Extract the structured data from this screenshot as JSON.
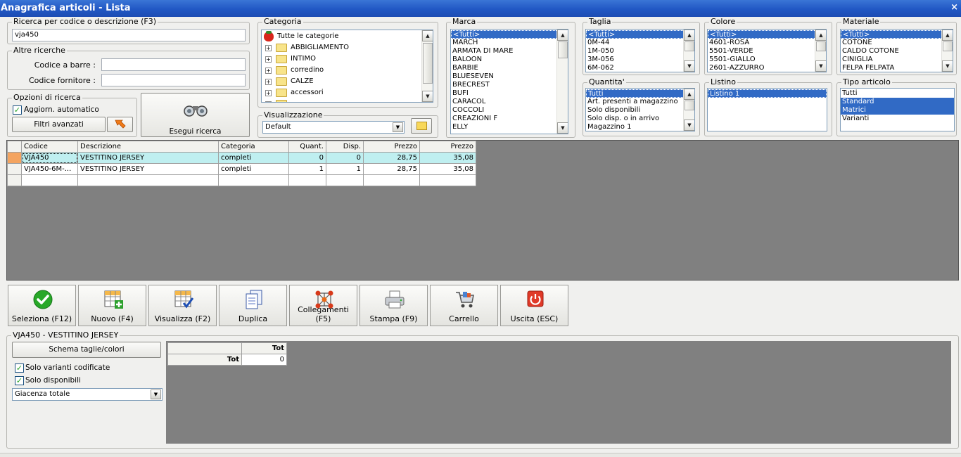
{
  "window": {
    "title": "Anagrafica articoli  - Lista",
    "close": "×"
  },
  "search": {
    "legend": "Ricerca per codice o descrizione (F3)",
    "value": "vja450"
  },
  "other_search": {
    "legend": "Altre ricerche",
    "barcode_label": "Codice a barre :",
    "barcode_value": "",
    "supplier_label": "Codice fornitore :",
    "supplier_value": ""
  },
  "search_options": {
    "legend": "Opzioni di ricerca",
    "auto_update_label": "Aggiorn. automatico",
    "auto_update_checked": true,
    "advanced_filters_label": "Filtri avanzati",
    "run_search_label": "Esegui ricerca"
  },
  "category": {
    "legend": "Categoria",
    "root": "Tutte le categorie",
    "items": [
      "ABBIGLIAMENTO",
      "INTIMO",
      "corredino",
      "CALZE",
      "accessori"
    ]
  },
  "view": {
    "legend": "Visualizzazione",
    "selected": "Default"
  },
  "brand": {
    "legend": "Marca",
    "items": [
      "<Tutti>",
      "MARCH",
      "ARMATA DI MARE",
      "BALOON",
      "BARBIE",
      "BLUESEVEN",
      "BRECREST",
      "BUFI",
      "CARACOL",
      "COCCOLI",
      "CREAZIONI F",
      "ELLY"
    ],
    "selected_index": 0
  },
  "size": {
    "legend": "Taglia",
    "items": [
      "<Tutti>",
      "0M-44",
      "1M-050",
      "3M-056",
      "6M-062"
    ],
    "selected_index": 0
  },
  "color": {
    "legend": "Colore",
    "items": [
      "<Tutti>",
      "4601-ROSA",
      "5501-VERDE",
      "5501-GIALLO",
      "2601-AZZURRO"
    ],
    "selected_index": 0
  },
  "material": {
    "legend": "Materiale",
    "items": [
      "<Tutti>",
      "COTONE",
      "CALDO COTONE",
      "CINIGLIA",
      "FELPA FELPATA"
    ],
    "selected_index": 0
  },
  "quantity": {
    "legend": "Quantita'",
    "items": [
      "Tutti",
      "Art. presenti a magazzino",
      "Solo disponibili",
      "Solo disp. o in arrivo",
      "Magazzino 1"
    ],
    "selected_index": 0
  },
  "price_list": {
    "legend": "Listino",
    "items": [
      "Listino 1"
    ],
    "selected_index": 0
  },
  "article_type": {
    "legend": "Tipo articolo",
    "items": [
      "Tutti",
      "Standard",
      "Matrici",
      "Varianti"
    ],
    "selected": [
      1,
      2
    ]
  },
  "grid": {
    "columns": [
      "Codice",
      "Descrizione",
      "Categoria",
      "Quant.",
      "Disp.",
      "Prezzo",
      "Prezzo"
    ],
    "rows": [
      [
        "VJA450",
        "VESTITINO JERSEY",
        "completi",
        "0",
        "0",
        "28,75",
        "35,08"
      ],
      [
        "VJA450-6M-...",
        "VESTITINO JERSEY",
        "completi",
        "1",
        "1",
        "28,75",
        "35,08"
      ]
    ]
  },
  "toolbar": [
    {
      "label": "Seleziona (F12)",
      "icon": "check-icon"
    },
    {
      "label": "Nuovo (F4)",
      "icon": "new-grid-icon"
    },
    {
      "label": "Visualizza (F2)",
      "icon": "view-grid-icon"
    },
    {
      "label": "Duplica",
      "icon": "duplicate-icon"
    },
    {
      "label": "Collegamenti (F5)",
      "icon": "links-icon"
    },
    {
      "label": "Stampa (F9)",
      "icon": "printer-icon"
    },
    {
      "label": "Carrello",
      "icon": "cart-icon"
    },
    {
      "label": "Uscita (ESC)",
      "icon": "power-icon"
    }
  ],
  "detail": {
    "legend": "VJA450 - VESTITINO JERSEY",
    "scheme_button": "Schema taglie/colori",
    "only_coded_variants": "Solo varianti codificate",
    "only_coded_checked": true,
    "only_available": "Solo disponibili",
    "only_available_checked": true,
    "stock_combo": "Giacenza totale",
    "matrix_col": "Tot",
    "matrix_row": "Tot",
    "matrix_value": "0"
  },
  "colors": {
    "titlebar": "#2157c4",
    "selection": "#316ac5",
    "row_highlight": "#bfeff0",
    "grid_bg": "#808080"
  }
}
